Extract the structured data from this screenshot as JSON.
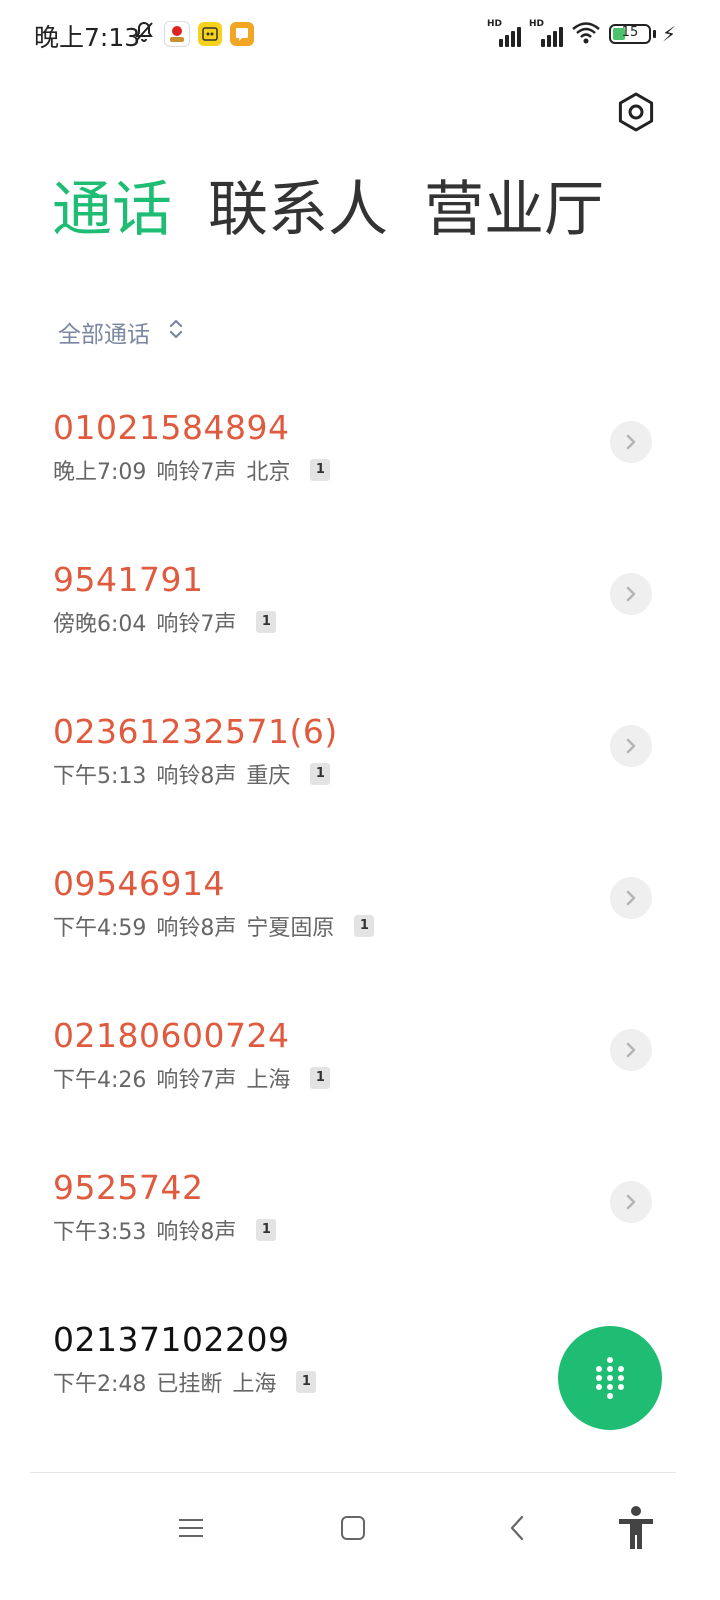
{
  "status_bar": {
    "time": "晚上7:13",
    "battery_level": "15",
    "signal_label_1": "HD",
    "signal_label_2": "HD",
    "icons": [
      "bell-off-icon",
      "app-icon-1",
      "app-icon-2",
      "app-icon-3",
      "signal-icon",
      "signal-icon",
      "wifi-icon",
      "battery-icon",
      "charging-icon"
    ]
  },
  "header": {
    "settings_icon": "settings-icon"
  },
  "tabs": [
    {
      "label": "通话",
      "active": true
    },
    {
      "label": "联系人",
      "active": false
    },
    {
      "label": "营业厅",
      "active": false
    }
  ],
  "filter": {
    "label": "全部通话"
  },
  "calls": [
    {
      "number": "01021584894",
      "time": "晚上7:09",
      "status": "响铃7声",
      "location": "北京",
      "sim": "1",
      "missed": true
    },
    {
      "number": "9541791",
      "time": "傍晚6:04",
      "status": "响铃7声",
      "location": "",
      "sim": "1",
      "missed": true
    },
    {
      "number": "02361232571(6)",
      "time": "下午5:13",
      "status": "响铃8声",
      "location": "重庆",
      "sim": "1",
      "missed": true
    },
    {
      "number": "09546914",
      "time": "下午4:59",
      "status": "响铃8声",
      "location": "宁夏固原",
      "sim": "1",
      "missed": true
    },
    {
      "number": "02180600724",
      "time": "下午4:26",
      "status": "响铃7声",
      "location": "上海",
      "sim": "1",
      "missed": true
    },
    {
      "number": "9525742",
      "time": "下午3:53",
      "status": "响铃8声",
      "location": "",
      "sim": "1",
      "missed": true
    },
    {
      "number": "02137102209",
      "time": "下午2:48",
      "status": "已挂断",
      "location": "上海",
      "sim": "1",
      "missed": false
    }
  ],
  "colors": {
    "accent": "#1ebd73",
    "missed": "#e05a3e",
    "filter": "#7b86a0"
  }
}
